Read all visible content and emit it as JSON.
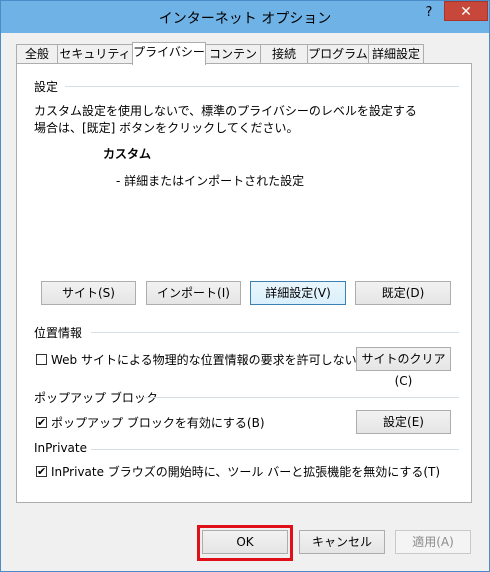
{
  "window": {
    "title": "インターネット オプション",
    "help_glyph": "?",
    "close_glyph": "✕"
  },
  "tabs": [
    {
      "label": "全般"
    },
    {
      "label": "セキュリティ"
    },
    {
      "label": "プライバシー"
    },
    {
      "label": "コンテンツ"
    },
    {
      "label": "接続"
    },
    {
      "label": "プログラム"
    },
    {
      "label": "詳細設定"
    }
  ],
  "settings": {
    "group_label": "設定",
    "description_line1": "カスタム設定を使用しないで、標準のプライバシーのレベルを設定する",
    "description_line2": "場合は、[既定] ボタンをクリックしてください。",
    "level_name": "カスタム",
    "level_detail": "- 詳細またはインポートされた設定",
    "buttons": {
      "sites": "サイト(S)",
      "import": "インポート(I)",
      "advanced": "詳細設定(V)",
      "default": "既定(D)"
    }
  },
  "location": {
    "group_label": "位置情報",
    "checkbox_label": "Web サイトによる物理的な位置情報の要求を許可しない(L)",
    "checked": false,
    "clear_button": "サイトのクリア(C)"
  },
  "popup": {
    "group_label": "ポップアップ ブロック",
    "checkbox_label": "ポップアップ ブロックを有効にする(B)",
    "checked": true,
    "settings_button": "設定(E)"
  },
  "inprivate": {
    "group_label": "InPrivate",
    "checkbox_label": "InPrivate ブラウズの開始時に、ツール バーと拡張機能を無効にする(T)",
    "checked": true
  },
  "footer": {
    "ok": "OK",
    "cancel": "キャンセル",
    "apply": "適用(A)"
  },
  "check_glyph": "✔",
  "colors": {
    "titlebar": "#6fb2e6",
    "close_button": "#c7483b",
    "highlight_frame": "#e0101a"
  }
}
